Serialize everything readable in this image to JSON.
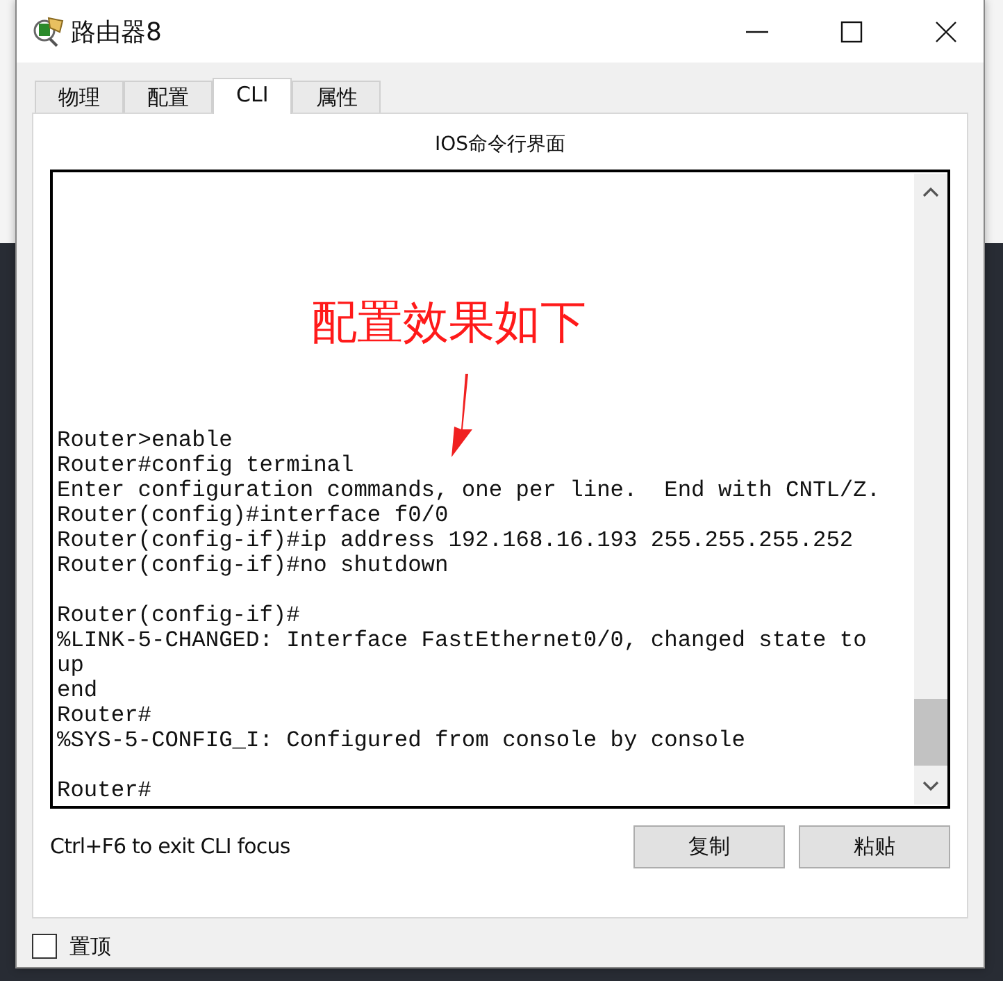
{
  "window": {
    "title": "路由器8"
  },
  "tabs": [
    {
      "label": "物理",
      "selected": false
    },
    {
      "label": "配置",
      "selected": false
    },
    {
      "label": "CLI",
      "selected": true
    },
    {
      "label": "属性",
      "selected": false
    }
  ],
  "panel_title": "IOS命令行界面",
  "annotation": "配置效果如下",
  "terminal_blocks": [
    [
      "Router>enable",
      "Router#config terminal",
      "Enter configuration commands, one per line.  End with CNTL/Z.",
      "Router(config)#interface f0/0",
      "Router(config-if)#ip address 192.168.16.193 255.255.255.252",
      "Router(config-if)#no shutdown"
    ],
    [
      "Router(config-if)#",
      "%LINK-5-CHANGED: Interface FastEthernet0/0, changed state to",
      "up",
      "end",
      "Router#",
      "%SYS-5-CONFIG_I: Configured from console by console"
    ],
    [
      "Router#"
    ]
  ],
  "hint": "Ctrl+F6 to exit CLI focus",
  "buttons": [
    "复制",
    "粘贴"
  ],
  "pin": {
    "label": "置顶",
    "checked": false
  }
}
